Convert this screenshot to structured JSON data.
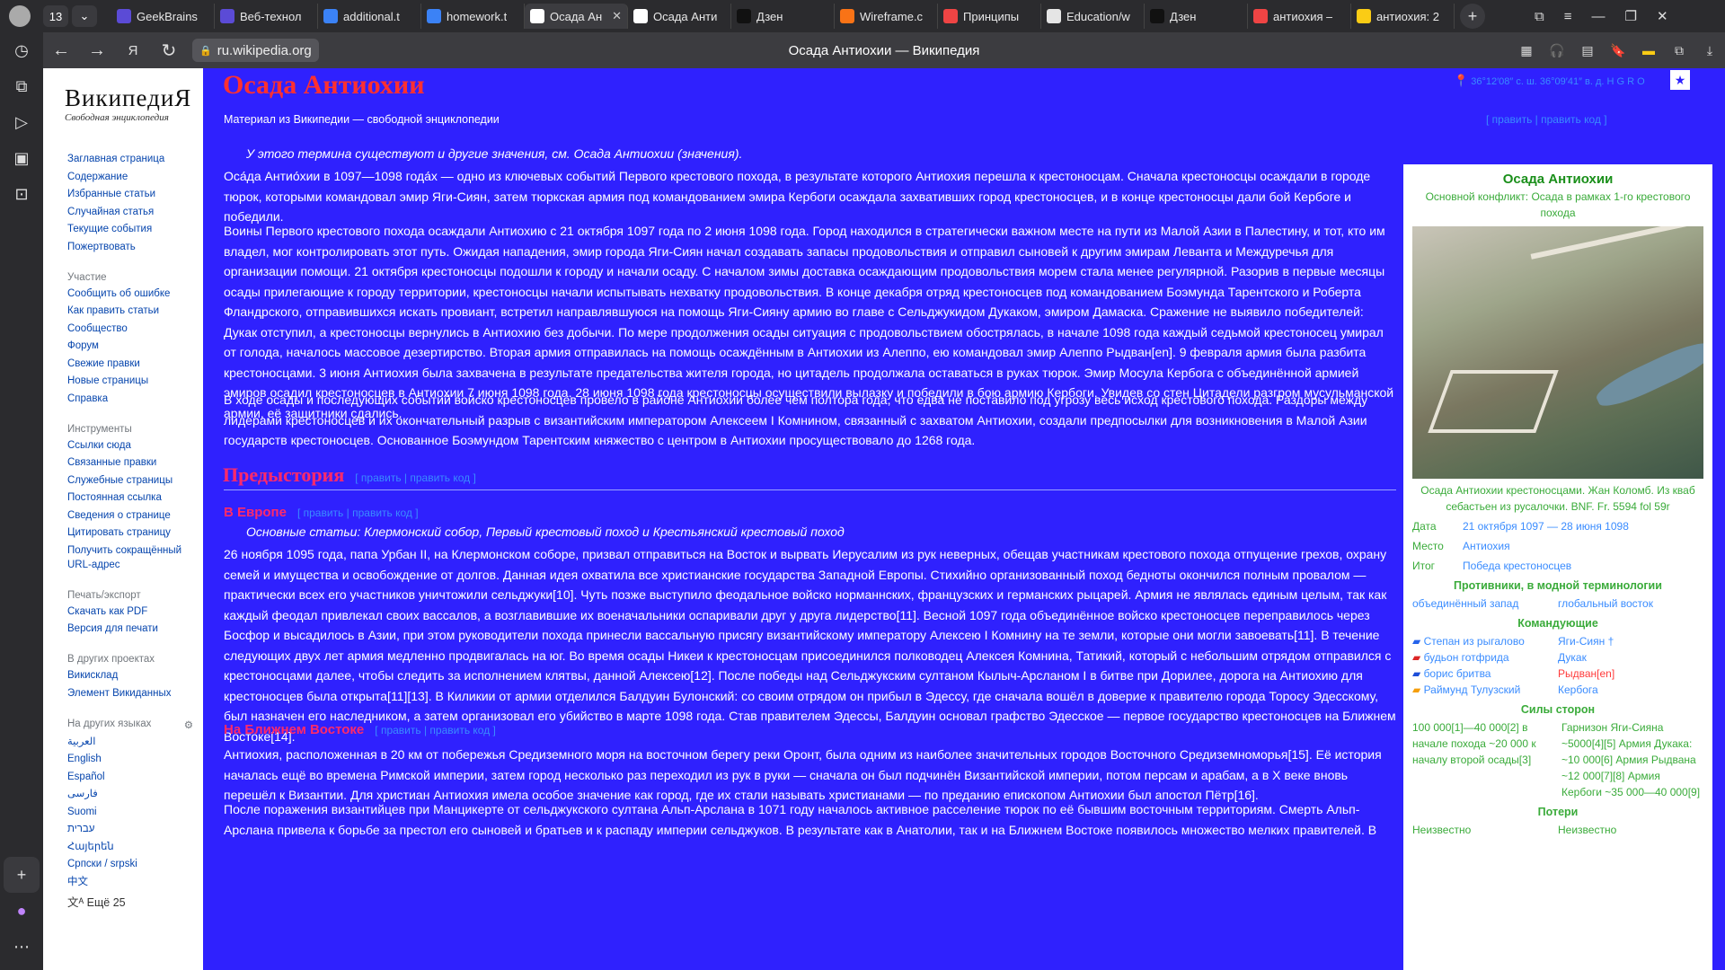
{
  "browser": {
    "tab_count": "13",
    "tabs": [
      {
        "title": "GeekBrains",
        "color": "#5b4bd6",
        "active": false
      },
      {
        "title": "Веб-технол",
        "color": "#5b4bd6",
        "active": false
      },
      {
        "title": "additional.t",
        "color": "#3b82f6",
        "active": false
      },
      {
        "title": "homework.t",
        "color": "#3b82f6",
        "active": false
      },
      {
        "title": "Осада Ан",
        "color": "#ffffff",
        "active": true
      },
      {
        "title": "Осада Анти",
        "color": "#ffffff",
        "active": false
      },
      {
        "title": "Дзен",
        "color": "#111111",
        "active": false
      },
      {
        "title": "Wireframe.c",
        "color": "#f97316",
        "active": false
      },
      {
        "title": "Принципы",
        "color": "#ef4444",
        "active": false
      },
      {
        "title": "Education/w",
        "color": "#e5e5e5",
        "active": false
      },
      {
        "title": "Дзен",
        "color": "#111111",
        "active": false
      },
      {
        "title": "антиохия –",
        "color": "#ef4444",
        "active": false
      },
      {
        "title": "антиохия: 2",
        "color": "#facc15",
        "active": false
      }
    ],
    "url": "ru.wikipedia.org",
    "page_title": "Осада Антиохии — Википедия"
  },
  "sidebar": {
    "logo": "ВикипедиЯ",
    "logo_sub": "Свободная энциклопедия",
    "nav": [
      "Заглавная страница",
      "Содержание",
      "Избранные статьи",
      "Случайная статья",
      "Текущие события",
      "Пожертвовать"
    ],
    "participation_head": "Участие",
    "participation": [
      "Сообщить об ошибке",
      "Как править статьи",
      "Сообщество",
      "Форум",
      "Свежие правки",
      "Новые страницы",
      "Справка"
    ],
    "tools_head": "Инструменты",
    "tools": [
      "Ссылки сюда",
      "Связанные правки",
      "Служебные страницы",
      "Постоянная ссылка",
      "Сведения о странице",
      "Цитировать страницу",
      "Получить сокращённый URL-адрес"
    ],
    "export_head": "Печать/экспорт",
    "export": [
      "Скачать как PDF",
      "Версия для печати"
    ],
    "projects_head": "В других проектах",
    "projects": [
      "Викисклад",
      "Элемент Викиданных"
    ],
    "langs_head": "На других языках",
    "langs": [
      "العربية",
      "English",
      "Español",
      "فارسی",
      "Suomi",
      "עברית",
      "Հայերեն",
      "Српски / srpski",
      "中文"
    ],
    "more_langs": "Ещё 25"
  },
  "article": {
    "title": "Осада Антиохии",
    "from": "Материал из Википедии — свободной энциклопедии",
    "edit_top": "[ править | править код ]",
    "coords": "36°12′08″ с. ш. 36°09′41″ в. д.  H G R O",
    "disambig": "У этого термина существуют и другие значения, см. Осада Антиохии (значения).",
    "p1": "Оса́да Антио́хии в 1097—1098 года́х — одно из ключевых событий Первого крестового похода, в результате которого Антиохия перешла к крестоносцам. Сначала крестоносцы осаждали в городе тюрок, которыми командовал эмир Яги-Сиян, затем тюркская армия под командованием эмира Кербоги осаждала захвативших город крестоносцев, и в конце крестоносцы дали бой Кербоге и победили.",
    "p2": "Воины Первого крестового похода осаждали Антиохию с 21 октября 1097 года по 2 июня 1098 года. Город находился в стратегически важном месте на пути из Малой Азии в Палестину, и тот, кто им владел, мог контролировать этот путь. Ожидая нападения, эмир города Яги-Сиян начал создавать запасы продовольствия и отправил сыновей к другим эмирам Леванта и Междуречья для организации помощи. 21 октября крестоносцы подошли к городу и начали осаду. С началом зимы доставка осаждающим продовольствия морем стала менее регулярной. Разорив в первые месяцы осады прилегающие к городу территории, крестоносцы начали испытывать нехватку продовольствия. В конце декабря отряд крестоносцев под командованием Боэмунда Тарентского и Роберта Фландрского, отправившихся искать провиант, встретил направлявшуюся на помощь Яги-Сияну армию во главе с Сельджукидом Дукаком, эмиром Дамаска. Сражение не выявило победителей: Дукак отступил, а крестоносцы вернулись в Антиохию без добычи. По мере продолжения осады ситуация с продовольствием обострялась, в начале 1098 года каждый седьмой крестоносец умирал от голода, началось массовое дезертирство. Вторая армия отправилась на помощь осаждённым в Антиохии из Алеппо, ею командовал эмир Алеппо Рыдван[en]. 9 февраля армия была разбита крестоносцами. 3 июня Антиохия была захвачена в результате предательства жителя города, но цитадель продолжала оставаться в руках тюрок. Эмир Мосула Кербога с объединённой армией эмиров осадил крестоносцев в Антиохии 7 июня 1098 года. 28 июня 1098 года крестоносцы осуществили вылазку и победили в бою армию Кербоги. Увидев со стен Цитадели разгром мусульманской армии, её защитники сдались.",
    "p3": "В ходе осады и последующих событий войско крестоносцев провело в районе Антиохии более чем полтора года, что едва не поставило под угрозу весь исход крестового похода. Раздоры между лидерами крестоносцев и их окончательный разрыв с византийским императором Алексеем I Комнином, связанный с захватом Антиохии, создали предпосылки для возникновения в Малой Азии государств крестоносцев. Основанное Боэмундом Тарентским княжество с центром в Антиохии просуществовало до 1268 года.",
    "h_prehistory": "Предыстория",
    "edit_links": "[ править | править код ]",
    "h_europe": "В Европе",
    "main_articles": "Основные статьи: Клермонский собор, Первый крестовый поход и Крестьянский крестовый поход",
    "p4": "26 ноября 1095 года, папа Урбан II, на Клермонском соборе, призвал отправиться на Восток и вырвать Иерусалим из рук неверных, обещав участникам крестового похода отпущение грехов, охрану семей и имущества и освобождение от долгов. Данная идея охватила все христианские государства Западной Европы. Стихийно организованный поход бедноты окончился полным провалом — практически всех его участников уничтожили сельджуки[10]. Чуть позже выступило феодальное войско норманнских, французских и германских рыцарей. Армия не являлась единым целым, так как каждый феодал привлекал своих вассалов, а возглавившие их военачальники оспаривали друг у друга лидерство[11]. Весной 1097 года объединённое войско крестоносцев переправилось через Босфор и высадилось в Азии, при этом руководители похода принесли вассальную присягу византийскому императору Алексею I Комнину на те земли, которые они могли завоевать[11]. В течение следующих двух лет армия медленно продвигалась на юг. Во время осады Никеи к крестоносцам присоединился полководец Алексея Комнина, Татикий, который с небольшим отрядом отправился с крестоносцами далее, чтобы следить за исполнением клятвы, данной Алексею[12]. После победы над Сельджукским султаном Кылыч-Арсланом I в битве при Дорилее, дорога на Антиохию для крестоносцев была открыта[11][13]. В Киликии от армии отделился Балдуин Булонский: со своим отрядом он прибыл в Эдессу, где сначала вошёл в доверие к правителю города Торосу Эдесскому, был назначен его наследником, а затем организовал его убийство в марте 1098 года. Став правителем Эдессы, Балдуин основал графство Эдесское — первое государство крестоносцев на Ближнем Востоке[14].",
    "h_neareast": "На Ближнем Востоке",
    "p5": "Антиохия, расположенная в 20 км от побережья Средиземного моря на восточном берегу реки Оронт, была одним из наиболее значительных городов Восточного Средиземноморья[15]. Её история началась ещё во времена Римской империи, затем город несколько раз переходил из рук в руки — сначала он был подчинён Византийской империи, потом персам и арабам, а в X веке вновь перешёл к Византии. Для христиан Антиохия имела особое значение как город, где их стали называть христианами — по преданию епископом Антиохии был апостол Пётр[16].",
    "p6": "После поражения византийцев при Манцикерте от сельджукского султана Альп-Арслана в 1071 году началось активное расселение тюрок по её бывшим восточным территориям. Смерть Альп-Арслана привела к борьбе за престол его сыновей и братьев и к распаду империи сельджуков. В результате как в Анатолии, так и на Ближнем Востоке появилось множество мелких правителей. В"
  },
  "infobox": {
    "title": "Осада Антиохии",
    "subtitle": "Основной конфликт: Осада в рамках 1-го крестового похода",
    "caption": "Осада Антиохии крестоносцами. Жан Коломб. Из кваб себастьен из русалочки. BNF. Fr. 5594 fol 59r",
    "date_k": "Дата",
    "date_v": "21 октября 1097 — 28 июня 1098",
    "place_k": "Место",
    "place_v": "Антиохия",
    "result_k": "Итог",
    "result_v": "Победа крестоносцев",
    "opponents_head": "Противники, в модной терминологии",
    "opp_left": "объединённый запад",
    "opp_right": "глобальный восток",
    "commanders_head": "Командующие",
    "cmd_left": [
      "Степан из рыгалово",
      "будьон готфрида",
      "борис бритва",
      "Раймунд Тулузский"
    ],
    "cmd_right": [
      "Яги-Сиян †",
      "Дукак",
      "Рыдван[en]",
      "Кербога"
    ],
    "forces_head": "Силы сторон",
    "forces_left": "100 000[1]—40 000[2] в начале похода ~20 000 к началу второй осады[3]",
    "forces_right": "Гарнизон Яги-Сияна ~5000[4][5] Армия Дукака: ~10 000[6] Армия Рыдвана ~12 000[7][8] Армия Кербоги ~35 000—40 000[9]",
    "losses_head": "Потери",
    "loss_left": "Неизвестно",
    "loss_right": "Неизвестно"
  }
}
